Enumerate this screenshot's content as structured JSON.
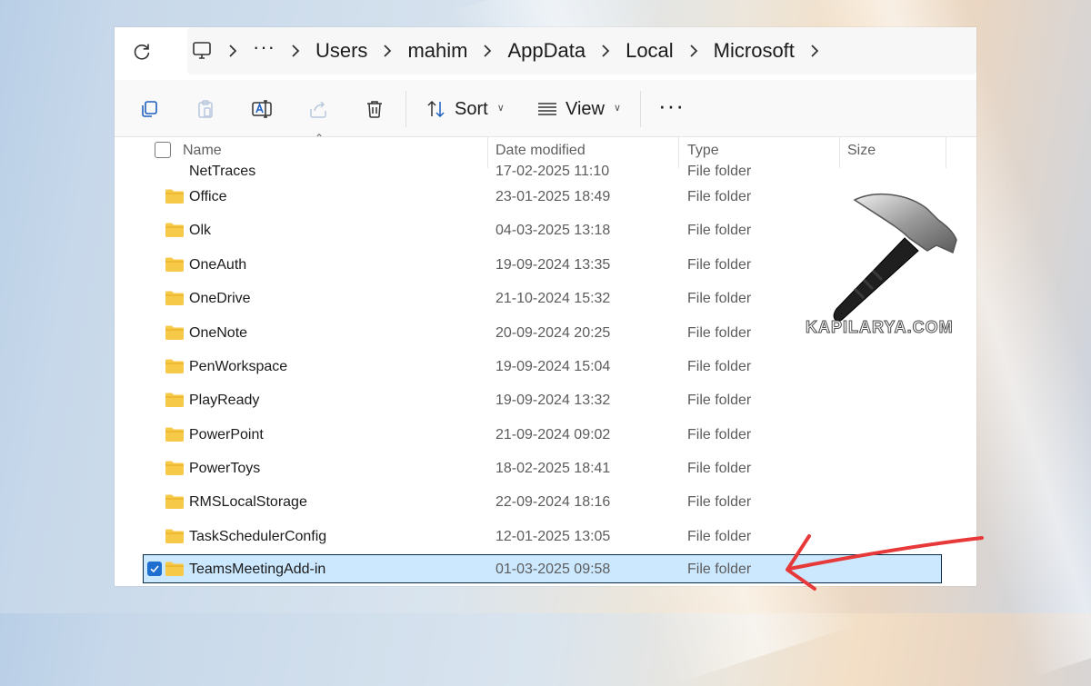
{
  "breadcrumb": {
    "items": [
      "Users",
      "mahim",
      "AppData",
      "Local",
      "Microsoft"
    ],
    "overflow": "···"
  },
  "toolbar": {
    "sort_label": "Sort",
    "view_label": "View",
    "more_label": "···"
  },
  "columns": {
    "name": "Name",
    "date": "Date modified",
    "type": "Type",
    "size": "Size"
  },
  "rows": [
    {
      "name": "NetTraces",
      "date": "17-02-2025 11:10",
      "type": "File folder"
    },
    {
      "name": "Office",
      "date": "23-01-2025 18:49",
      "type": "File folder"
    },
    {
      "name": "Olk",
      "date": "04-03-2025 13:18",
      "type": "File folder"
    },
    {
      "name": "OneAuth",
      "date": "19-09-2024 13:35",
      "type": "File folder"
    },
    {
      "name": "OneDrive",
      "date": "21-10-2024 15:32",
      "type": "File folder"
    },
    {
      "name": "OneNote",
      "date": "20-09-2024 20:25",
      "type": "File folder"
    },
    {
      "name": "PenWorkspace",
      "date": "19-09-2024 15:04",
      "type": "File folder"
    },
    {
      "name": "PlayReady",
      "date": "19-09-2024 13:32",
      "type": "File folder"
    },
    {
      "name": "PowerPoint",
      "date": "21-09-2024 09:02",
      "type": "File folder"
    },
    {
      "name": "PowerToys",
      "date": "18-02-2025 18:41",
      "type": "File folder"
    },
    {
      "name": "RMSLocalStorage",
      "date": "22-09-2024 18:16",
      "type": "File folder"
    },
    {
      "name": "TaskSchedulerConfig",
      "date": "12-01-2025 13:05",
      "type": "File folder"
    },
    {
      "name": "TeamsMeetingAdd-in",
      "date": "01-03-2025 09:58",
      "type": "File folder",
      "selected": true
    }
  ],
  "watermark": "KAPILARYA.COM",
  "colors": {
    "selection": "#cce8ff",
    "folder": "#f7c948",
    "annotation_arrow": "#e8393a"
  }
}
